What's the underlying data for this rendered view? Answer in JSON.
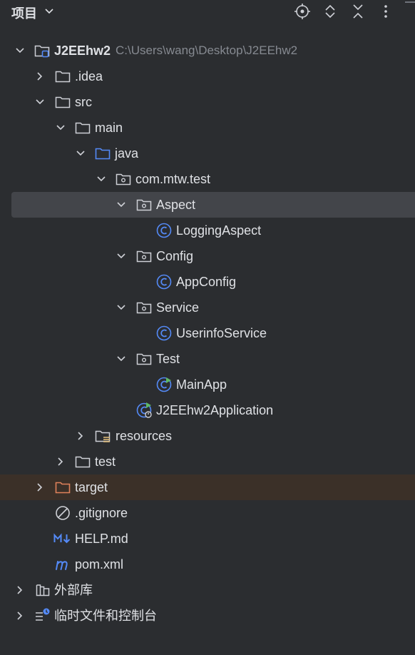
{
  "header": {
    "title": "项目",
    "icons": [
      "locate-icon",
      "expand-all-icon",
      "collapse-all-icon",
      "more-options-icon"
    ]
  },
  "tree": {
    "project": {
      "label": "J2EEhw2",
      "path": "C:\\Users\\wang\\Desktop\\J2EEhw2"
    },
    "idea": {
      "label": ".idea"
    },
    "src": {
      "label": "src"
    },
    "main": {
      "label": "main"
    },
    "java": {
      "label": "java"
    },
    "package": {
      "label": "com.mtw.test"
    },
    "aspect": {
      "label": "Aspect"
    },
    "logging_aspect": {
      "label": "LoggingAspect"
    },
    "config": {
      "label": "Config"
    },
    "app_config": {
      "label": "AppConfig"
    },
    "service": {
      "label": "Service"
    },
    "userinfo_service": {
      "label": "UserinfoService"
    },
    "test_pkg": {
      "label": "Test"
    },
    "main_app": {
      "label": "MainApp"
    },
    "application": {
      "label": "J2EEhw2Application"
    },
    "resources": {
      "label": "resources"
    },
    "test": {
      "label": "test"
    },
    "target": {
      "label": "target"
    },
    "gitignore": {
      "label": ".gitignore"
    },
    "help_md": {
      "label": "HELP.md"
    },
    "pom": {
      "label": "pom.xml"
    },
    "external_libs": {
      "label": "外部库"
    },
    "scratches": {
      "label": "临时文件和控制台"
    }
  },
  "colors": {
    "background": "#2b2d30",
    "selection": "#43454a",
    "excluded_row": "#3b3028",
    "class_icon": "#548af7",
    "source_folder": "#548af7",
    "excluded_folder": "#e0825b",
    "muted_text": "#868a91"
  }
}
